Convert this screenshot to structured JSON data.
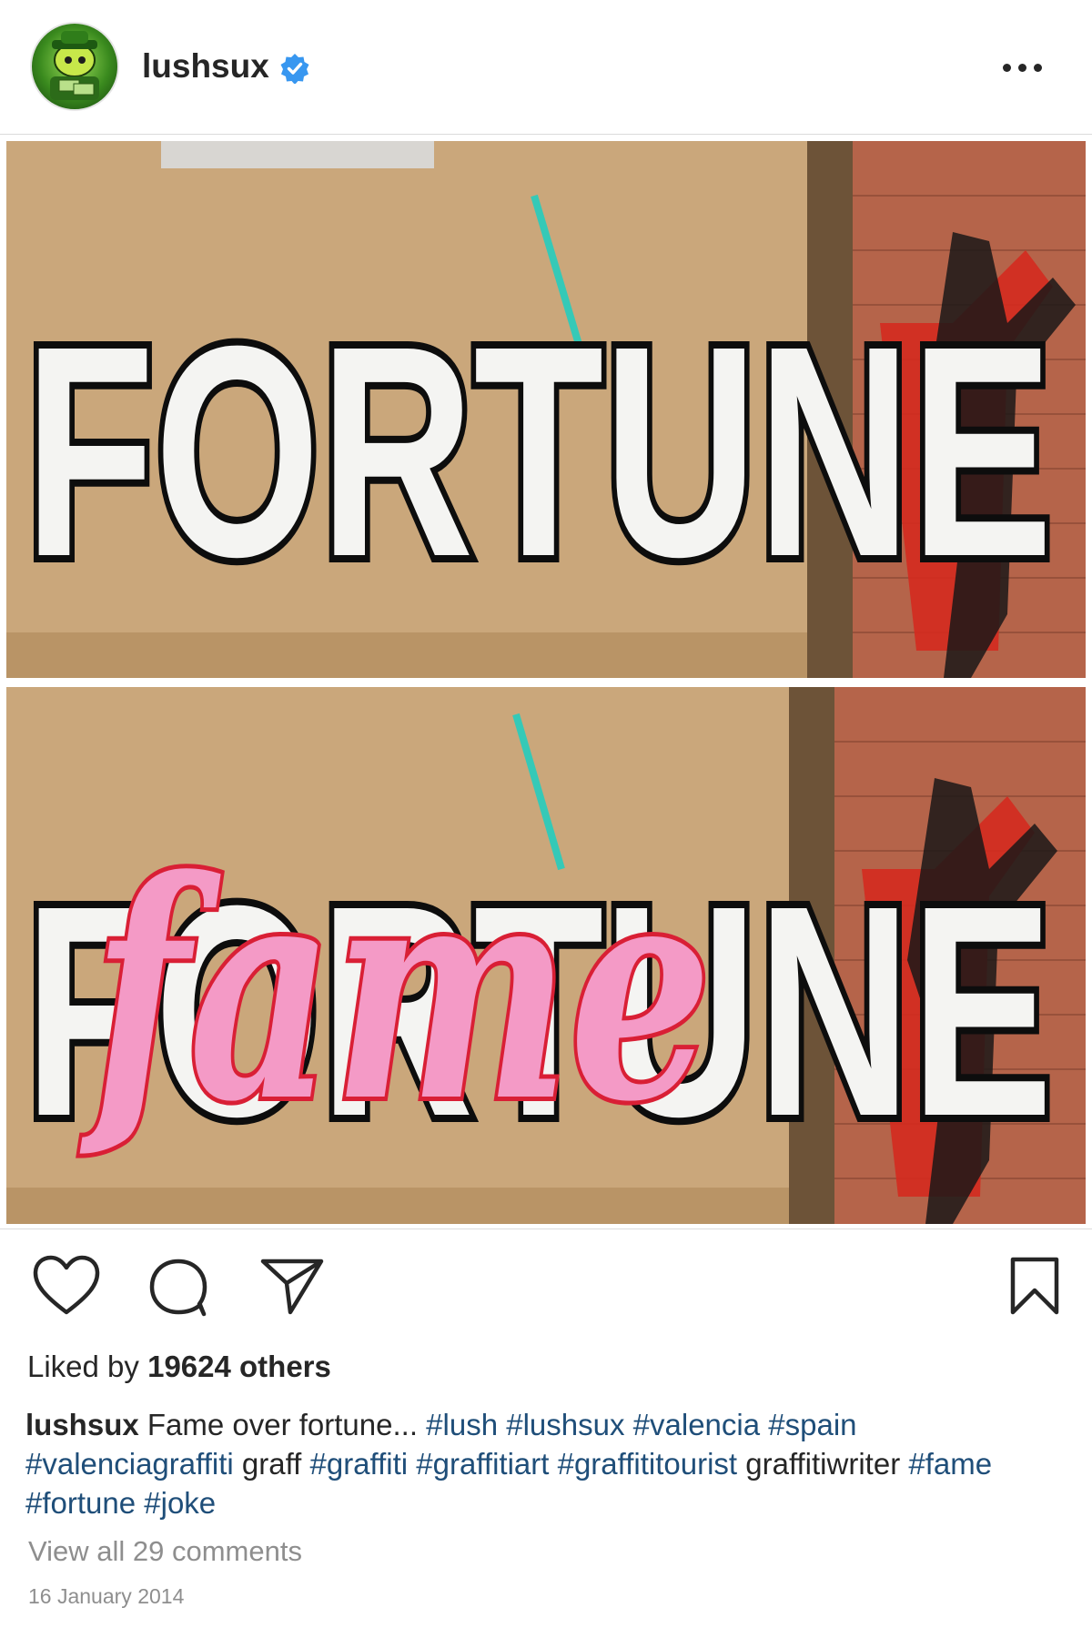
{
  "post": {
    "username": "lushsux",
    "verified": true,
    "likes_prefix": "Liked by ",
    "likes_count": "19624 others",
    "caption": {
      "user": "lushsux",
      "segments": [
        {
          "text": " Fame over fortune... ",
          "tag": false
        },
        {
          "text": "#lush",
          "tag": true
        },
        {
          "text": " ",
          "tag": false
        },
        {
          "text": "#lushsux",
          "tag": true
        },
        {
          "text": " ",
          "tag": false
        },
        {
          "text": "#valencia",
          "tag": true
        },
        {
          "text": " ",
          "tag": false
        },
        {
          "text": "#spain",
          "tag": true
        },
        {
          "text": " ",
          "tag": false
        },
        {
          "text": "#valenciagraffiti",
          "tag": true
        },
        {
          "text": " graff ",
          "tag": false
        },
        {
          "text": "#graffiti",
          "tag": true
        },
        {
          "text": " ",
          "tag": false
        },
        {
          "text": "#graffitiart",
          "tag": true
        },
        {
          "text": " ",
          "tag": false
        },
        {
          "text": "#graffititourist",
          "tag": true
        },
        {
          "text": " graffitiwriter ",
          "tag": false
        },
        {
          "text": "#fame",
          "tag": true
        },
        {
          "text": " ",
          "tag": false
        },
        {
          "text": "#fortune",
          "tag": true
        },
        {
          "text": " ",
          "tag": false
        },
        {
          "text": "#joke",
          "tag": true
        }
      ]
    },
    "view_comments": "View all 29 comments",
    "date": "16 January 2014"
  },
  "photo": {
    "top_word": "FORTUNE",
    "bottom_word": "FORTUNE",
    "overlay_word": "fame"
  },
  "icons": {
    "like": "heart-icon",
    "comment": "comment-icon",
    "share": "paper-plane-icon",
    "save": "bookmark-icon",
    "more": "more-dots-icon",
    "verified": "verified-badge-icon"
  },
  "colors": {
    "text": "#262626",
    "muted": "#8e8e8e",
    "hashtag": "#1f4e79",
    "verified": "#3897f0",
    "wall": "#c9a67a",
    "graffiti_pink": "#f49ac6",
    "graffiti_outline": "#d91f35"
  }
}
